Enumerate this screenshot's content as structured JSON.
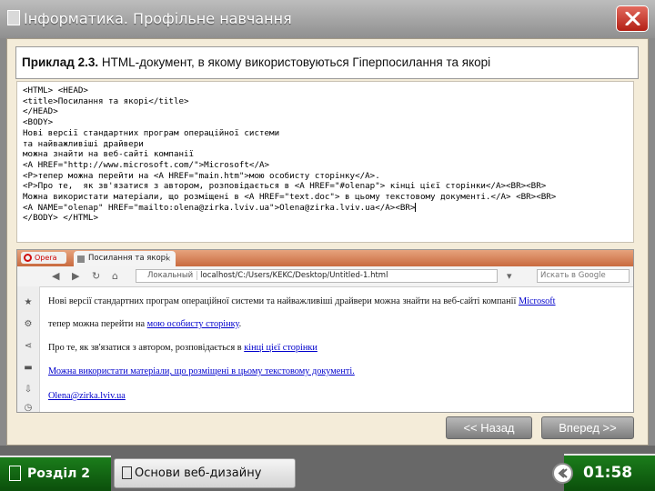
{
  "window": {
    "title": "Інформатика. Профільне навчання",
    "title_icon": "book-icon",
    "close_icon": "close-icon"
  },
  "example": {
    "label": "Приклад 2.3.",
    "text": " HTML-документ, в якому використовуються Гіперпосилання та якорі"
  },
  "code": {
    "lines": [
      "<HTML> <HEAD>",
      "<title>Посилання та якорі</title>",
      "</HEAD>",
      "<BODY>",
      "Нові версії стандартних програм операційної системи",
      "та найважливіші драйвери",
      "можна знайти на веб-сайті компанії",
      "<A HREF=\"http://www.microsoft.com/\">Microsoft</A>",
      "<P>тепер можна перейти на <A HREF=\"main.htm\">мою особисту сторінку</A>.",
      "<P>Про те,  як зв'язатися з автором, розповідається в <A HREF=\"#olenap\"> кінці цієї сторінки</A><BR><BR>",
      "Можна використати матеріали, що розміщені в <A HREF=\"text.doc\"> в цьому текстовому документі.</A> <BR><BR>",
      "<A NAME=\"olenap\" HREF=\"mailto:olena@zirka.lviv.ua\">Olena@zirka.lviv.ua</A><BR>",
      "</BODY> </HTML>"
    ]
  },
  "browser": {
    "app_label": "Opera",
    "tab_title": "Посилання та якорі",
    "tab_close": "×",
    "address_location": "Локальный",
    "address_url": "localhost/C:/Users/KEKC/Desktop/Untitled-1.html",
    "search_placeholder": "Искать в Google",
    "content": {
      "line1_text": "Нові версії стандартних програм операційної системи та найважливіші драйвери можна знайти на веб-сайті компанії ",
      "line1_link": "Microsoft",
      "line2_text": "тепер можна перейти на ",
      "line2_link": "мою особисту сторінку",
      "line2_end": ".",
      "line3_text": "Про те, як зв'язатися з автором, розповідається в ",
      "line3_link": "кінці цієї сторінки",
      "line4_link": "Можна використати матеріали, що розміщені в цьому текстовому документі.",
      "line5_link": "Olena@zirka.lviv.ua"
    }
  },
  "navigation": {
    "back_label": "<< Назад",
    "forward_label": "Вперед >>"
  },
  "status": {
    "section_label": "Розділ 2",
    "topic_label": "Основи веб-дизайну",
    "timer": "01:58"
  },
  "colors": {
    "accent_green": "#136613",
    "close_red": "#c9342a",
    "link_blue": "#0000cc"
  }
}
